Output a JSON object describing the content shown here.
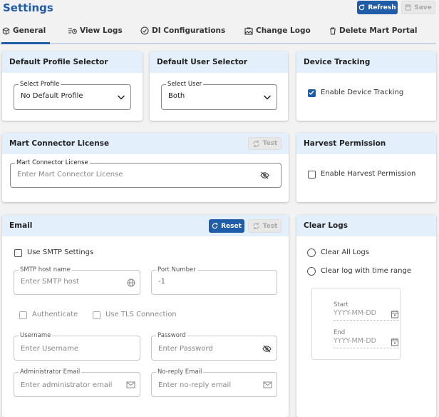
{
  "page": {
    "title": "Settings"
  },
  "toolbar": {
    "refresh_label": "Refresh",
    "save_label": "Save"
  },
  "tabs": [
    {
      "label": "General",
      "icon": "cube-icon",
      "active": true
    },
    {
      "label": "View Logs",
      "icon": "log-list-icon"
    },
    {
      "label": "DI Configurations",
      "icon": "gauge-icon"
    },
    {
      "label": "Change Logo",
      "icon": "image-icon"
    },
    {
      "label": "Delete Mart Portal",
      "icon": "trash-icon"
    }
  ],
  "default_profile": {
    "title": "Default Profile Selector",
    "field_label": "Select Profile",
    "value": "No Default Profile"
  },
  "default_user": {
    "title": "Default User Selector",
    "field_label": "Select User",
    "value": "Both"
  },
  "device_tracking": {
    "title": "Device Tracking",
    "checkbox_label": "Enable Device Tracking",
    "checked": true
  },
  "mart_connector": {
    "title": "Mart Connector License",
    "test_label": "Test",
    "field_label": "Mart Connector License",
    "placeholder": "Enter Mart Connector License"
  },
  "harvest": {
    "title": "Harvest Permission",
    "checkbox_label": "Enable Harvest Permission",
    "checked": false
  },
  "email": {
    "title": "Email",
    "reset_label": "Reset",
    "test_label": "Test",
    "use_smtp_label": "Use SMTP Settings",
    "smtp_host": {
      "label": "SMTP host name",
      "placeholder": "Enter SMTP host"
    },
    "port": {
      "label": "Port Number",
      "value": "-1"
    },
    "authenticate_label": "Authenticate",
    "tls_label": "Use TLS Connection",
    "username": {
      "label": "Username",
      "placeholder": "Enter Username"
    },
    "password": {
      "label": "Password",
      "placeholder": "Enter Password"
    },
    "admin_email": {
      "label": "Administrator Email",
      "placeholder": "Enter administrator email"
    },
    "noreply_email": {
      "label": "No-reply Email",
      "placeholder": "Enter no-reply email"
    }
  },
  "clear_logs": {
    "title": "Clear Logs",
    "option_all": "Clear All Logs",
    "option_range": "Clear log with time range",
    "start_label": "Start",
    "start_placeholder": "YYYY-MM-DD",
    "end_label": "End",
    "end_placeholder": "YYYY-MM-DD"
  },
  "colors": {
    "accent": "#1f5da8",
    "card_header": "#e3effb",
    "background": "#f2f2f2"
  }
}
